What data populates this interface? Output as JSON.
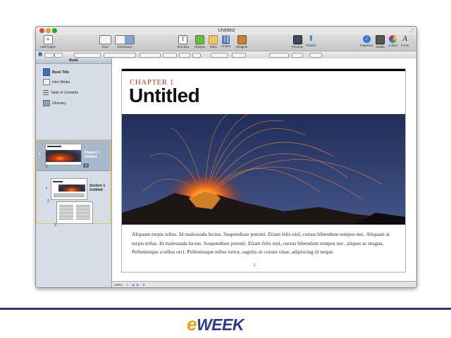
{
  "window": {
    "title": "Untitled"
  },
  "toolbar": {
    "add_pages": "Add Pages",
    "view": "View",
    "orientation": "Orientation",
    "text_box": "Text Box",
    "shapes": "Shapes",
    "table": "Table",
    "charts": "Charts",
    "widgets": "Widgets",
    "preview": "Preview",
    "publish": "Publish",
    "inspector": "Inspector",
    "media": "Media",
    "colors": "Colors",
    "fonts": "Fonts"
  },
  "sidebar": {
    "header": "Book",
    "items": [
      {
        "label": "Book Title",
        "icon": "book-icon"
      },
      {
        "label": "Intro Media",
        "icon": "film-icon"
      },
      {
        "label": "Table of Contents",
        "icon": "list-icon"
      },
      {
        "label": "Glossary",
        "icon": "glossary-icon"
      }
    ],
    "chapter_label": "Chapter 1",
    "chapter_title": "Untitled",
    "section_label": "Section 1",
    "section_title": "Untitled",
    "thumb_nums": [
      "1",
      "2",
      "3"
    ]
  },
  "page": {
    "chapter": "CHAPTER 1",
    "title": "Untitled",
    "caption": "Aliquam turpis tellus. Id malesuada lectus. Suspendisse potenti. Etiam felis nisl, cursus bibendum tempus nec. Aliquam at turpis tellus. Id malesuada lectus. Suspendisse potenti. Etiam felis nisl, cursus bibendum tempus nec, aliquet ac magna. Pellentesque a tellus orci. Pellentesque tellus tortor, sagittis ut cursus vitae, adipiscing id neque.",
    "number": "1"
  },
  "status": {
    "zoom": "100%"
  },
  "footer": {
    "logo_e": "e",
    "logo_rest": "WEEK"
  },
  "colors": {
    "accent_red": "#c0392b",
    "brand_blue": "#2d3a8c",
    "brand_orange": "#e8a020"
  }
}
